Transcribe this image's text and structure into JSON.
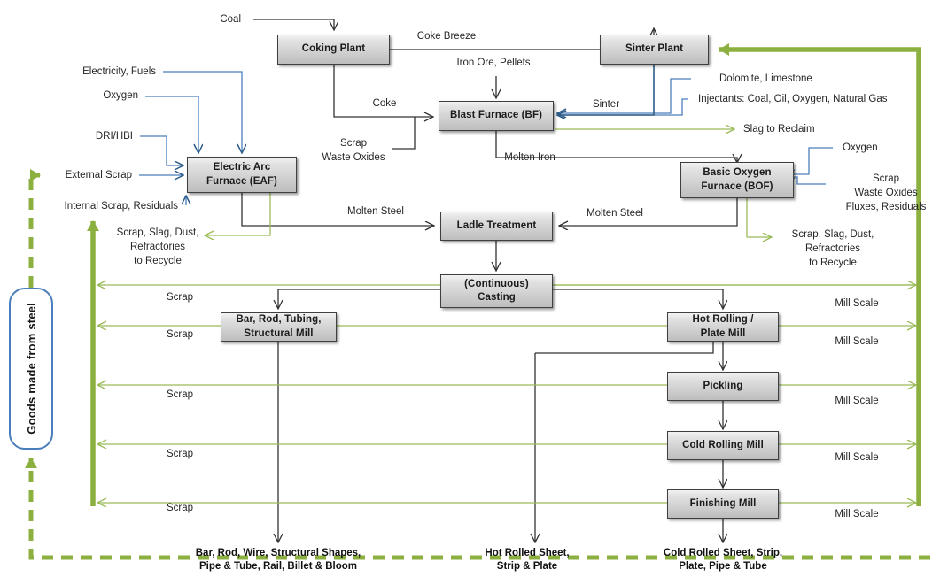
{
  "diagram": {
    "title": "Steel production material flow",
    "colors": {
      "box_border": "#3f3f3f",
      "flow_black": "#404040",
      "flow_blue": "#4a7ebb",
      "flow_green": "#9bbb59",
      "goods_border": "#4a7ebb"
    }
  },
  "boxes": [
    {
      "id": "coking-plant",
      "label": "Coking Plant"
    },
    {
      "id": "sinter-plant",
      "label": "Sinter Plant"
    },
    {
      "id": "blast-furnace",
      "label": "Blast Furnace (BF)"
    },
    {
      "id": "electric-arc-furnace",
      "label": "Electric Arc\nFurnace (EAF)"
    },
    {
      "id": "basic-oxygen-furnace",
      "label": "Basic Oxygen\nFurnace (BOF)"
    },
    {
      "id": "ladle-treatment",
      "label": "Ladle Treatment"
    },
    {
      "id": "continuous-casting",
      "label": "(Continuous)\nCasting"
    },
    {
      "id": "bar-rod-tubing-structural-mill",
      "label": "Bar, Rod, Tubing,\nStructural Mill"
    },
    {
      "id": "hot-rolling-plate-mill",
      "label": "Hot Rolling /\nPlate Mill"
    },
    {
      "id": "pickling",
      "label": "Pickling"
    },
    {
      "id": "cold-rolling-mill",
      "label": "Cold Rolling Mill"
    },
    {
      "id": "finishing-mill",
      "label": "Finishing Mill"
    }
  ],
  "box_labels": {
    "coking_plant": "Coking Plant",
    "sinter_plant": "Sinter Plant",
    "blast_furnace": "Blast Furnace (BF)",
    "eaf_line1": "Electric Arc",
    "eaf_line2": "Furnace (EAF)",
    "bof_line1": "Basic Oxygen",
    "bof_line2": "Furnace (BOF)",
    "ladle_treatment": "Ladle Treatment",
    "casting_line1": "(Continuous)",
    "casting_line2": "Casting",
    "bar_mill_line1": "Bar, Rod, Tubing,",
    "bar_mill_line2": "Structural Mill",
    "hot_rolling_line1": "Hot Rolling /",
    "hot_rolling_line2": "Plate Mill",
    "pickling": "Pickling",
    "cold_rolling_mill": "Cold Rolling Mill",
    "finishing_mill": "Finishing Mill"
  },
  "goods_box": {
    "label": "Goods made from steel"
  },
  "flow_labels": {
    "coal": "Coal",
    "coke_breeze": "Coke Breeze",
    "iron_ore_pellets": "Iron Ore, Pellets",
    "coke": "Coke",
    "sinter": "Sinter",
    "dolomite_limestone": "Dolomite, Limestone",
    "injectants": "Injectants: Coal, Oil, Oxygen, Natural Gas",
    "slag_to_reclaim": "Slag to Reclaim",
    "electricity_fuels": "Electricity, Fuels",
    "oxygen_eaf": "Oxygen",
    "dri_hbi": "DRI/HBI",
    "external_scrap": "External Scrap",
    "internal_scrap_residuals": "Internal  Scrap, Residuals",
    "scrap_bf_l1": "Scrap",
    "scrap_bf_l2": "Waste Oxides",
    "molten_iron": "Molten Iron",
    "oxygen_bof": "Oxygen",
    "bof_inputs_l1": "Scrap",
    "bof_inputs_l2": "Waste Oxides",
    "bof_inputs_l3": "Fluxes, Residuals",
    "molten_steel_left": "Molten Steel",
    "molten_steel_right": "Molten Steel",
    "recycle_eaf_l1": "Scrap, Slag, Dust,",
    "recycle_eaf_l2": "Refractories",
    "recycle_eaf_l3": "to Recycle",
    "recycle_bof_l1": "Scrap, Slag, Dust,",
    "recycle_bof_l2": "Refractories",
    "recycle_bof_l3": "to Recycle"
  },
  "scrap_returns": [
    {
      "label": "Scrap"
    },
    {
      "label": "Scrap"
    },
    {
      "label": "Scrap"
    },
    {
      "label": "Scrap"
    },
    {
      "label": "Scrap"
    }
  ],
  "mill_scale_returns": [
    {
      "label": "Mill Scale"
    },
    {
      "label": "Mill Scale"
    },
    {
      "label": "Mill Scale"
    },
    {
      "label": "Mill Scale"
    },
    {
      "label": "Mill Scale"
    }
  ],
  "outputs": [
    {
      "id": "long-products",
      "line1": "Bar, Rod, Wire, Structural Shapes,",
      "line2": "Pipe & Tube, Rail,  Billet & Bloom"
    },
    {
      "id": "hot-rolled-products",
      "line1": "Hot Rolled Sheet,",
      "line2": "Strip &  Plate"
    },
    {
      "id": "cold-rolled-products",
      "line1": "Cold Rolled Sheet, Strip,",
      "line2": "Plate, Pipe & Tube"
    }
  ]
}
